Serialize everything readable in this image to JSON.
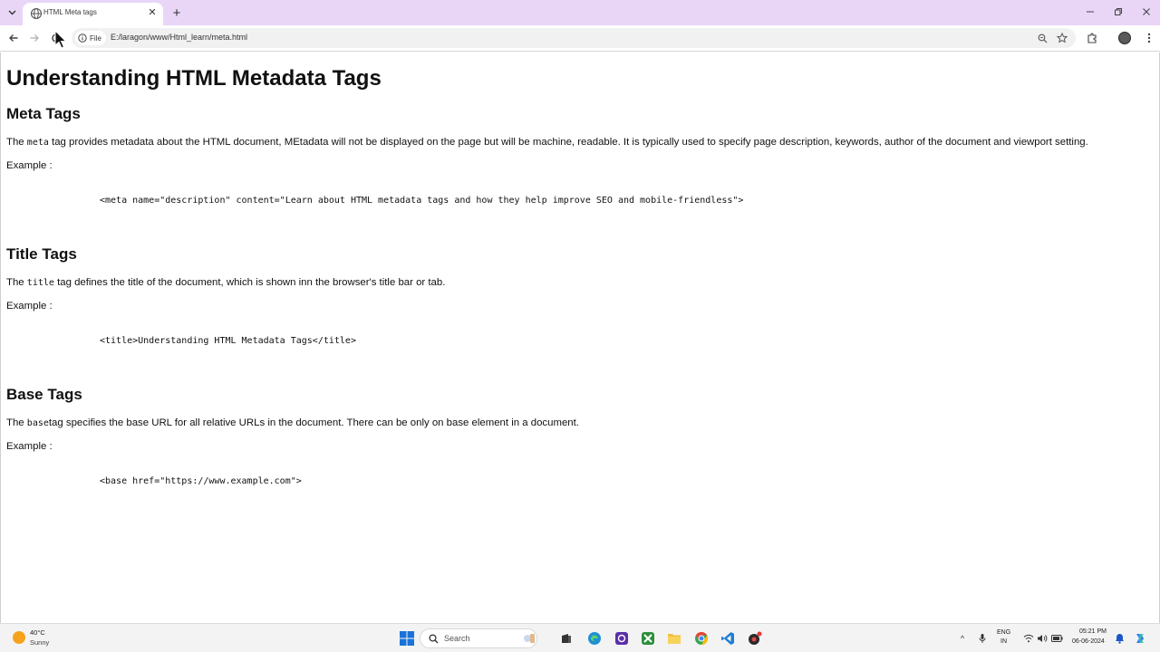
{
  "browser": {
    "tab_title": "HTML Meta tags",
    "site_chip_label": "File",
    "url": "E:/laragon/www/Html_learn/meta.html"
  },
  "page": {
    "title": "Understanding HTML Metadata Tags",
    "example_label": "Example :",
    "sections": [
      {
        "heading": "Meta Tags",
        "text_before": "The ",
        "code": "meta",
        "text_after": " tag provides metadata about the HTML document, MEtadata will not be displayed on the page but will be machine, readable. It is typically used to specify page description, keywords, author of the document and viewport setting.",
        "example_code": "<meta name=\"description\" content=\"Learn about HTML metadata tags and how they help improve SEO and mobile-friendless\">"
      },
      {
        "heading": "Title Tags",
        "text_before": "The ",
        "code": "title",
        "text_after": " tag defines the title of the document, which is shown inn the browser's title bar or tab.",
        "example_code": "<title>Understanding HTML Metadata Tags</title>"
      },
      {
        "heading": "Base Tags",
        "text_before": "The ",
        "code": "base",
        "text_after": "tag specifies the base URL for all relative URLs in the document. There can be only on base element in a document.",
        "example_code": "<base href=\"https://www.example.com\">"
      }
    ]
  },
  "taskbar": {
    "weather_temp": "40°C",
    "weather_desc": "Sunny",
    "search_label": "Search",
    "language_line1": "ENG",
    "language_line2": "IN",
    "time": "05:21 PM",
    "date": "06-06-2024"
  },
  "colors": {
    "tabstrip": "#e9d6f7",
    "page_background": "#ffffff",
    "taskbar": "#f3f3f3"
  }
}
